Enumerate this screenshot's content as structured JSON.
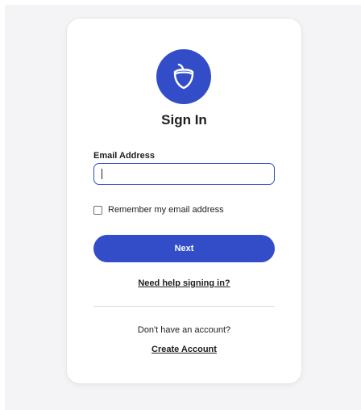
{
  "logo": {
    "icon": "acorn-icon",
    "color": "#324dc7"
  },
  "signin": {
    "title": "Sign In",
    "email_label": "Email Address",
    "email_value": "",
    "remember_label": "Remember my email address",
    "remember_checked": false,
    "next_label": "Next",
    "help_link": "Need help signing in?"
  },
  "account": {
    "prompt": "Don't have an account?",
    "create_link": "Create Account"
  },
  "colors": {
    "accent": "#324dc7",
    "background": "#f4f4f7"
  }
}
